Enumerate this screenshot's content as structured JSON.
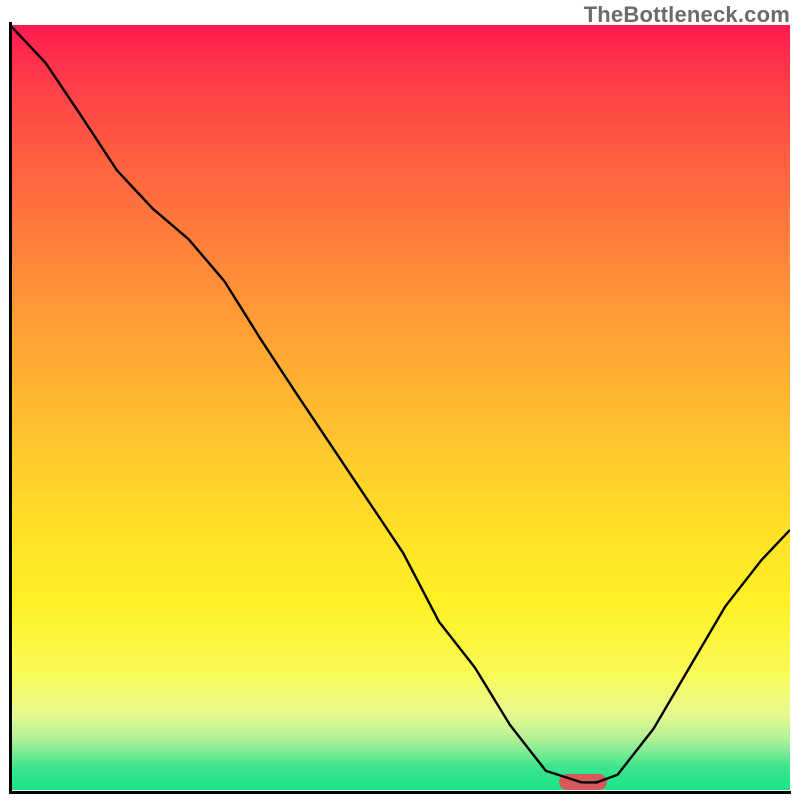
{
  "watermark": "TheBottleneck.com",
  "chart_data": {
    "type": "line",
    "title": "",
    "xlabel": "",
    "ylabel": "",
    "xlim": [
      0,
      100
    ],
    "ylim": [
      0,
      100
    ],
    "grid": false,
    "series": [
      {
        "name": "bottleneck-curve",
        "x": [
          0.0,
          4.6,
          9.2,
          13.7,
          18.3,
          22.9,
          27.5,
          32.1,
          36.6,
          41.2,
          45.8,
          50.4,
          55.0,
          59.6,
          64.1,
          68.7,
          73.3,
          75.2,
          77.9,
          82.5,
          87.1,
          91.7,
          96.3,
          100.0
        ],
        "y": [
          100.0,
          95.0,
          88.0,
          81.0,
          76.0,
          72.0,
          66.5,
          59.0,
          52.0,
          45.0,
          38.0,
          31.0,
          22.0,
          16.0,
          8.5,
          2.5,
          1.0,
          1.0,
          2.0,
          8.0,
          16.0,
          24.0,
          30.0,
          34.0
        ]
      }
    ],
    "marker": {
      "x": 73.5,
      "y": 1.0,
      "color": "#d65a5a",
      "shape": "pill"
    },
    "colors": {
      "gradient_top": "#ff1a4f",
      "gradient_mid": "#ffe027",
      "gradient_bottom": "#19e58b",
      "curve": "#000000",
      "axis": "#000000"
    }
  }
}
